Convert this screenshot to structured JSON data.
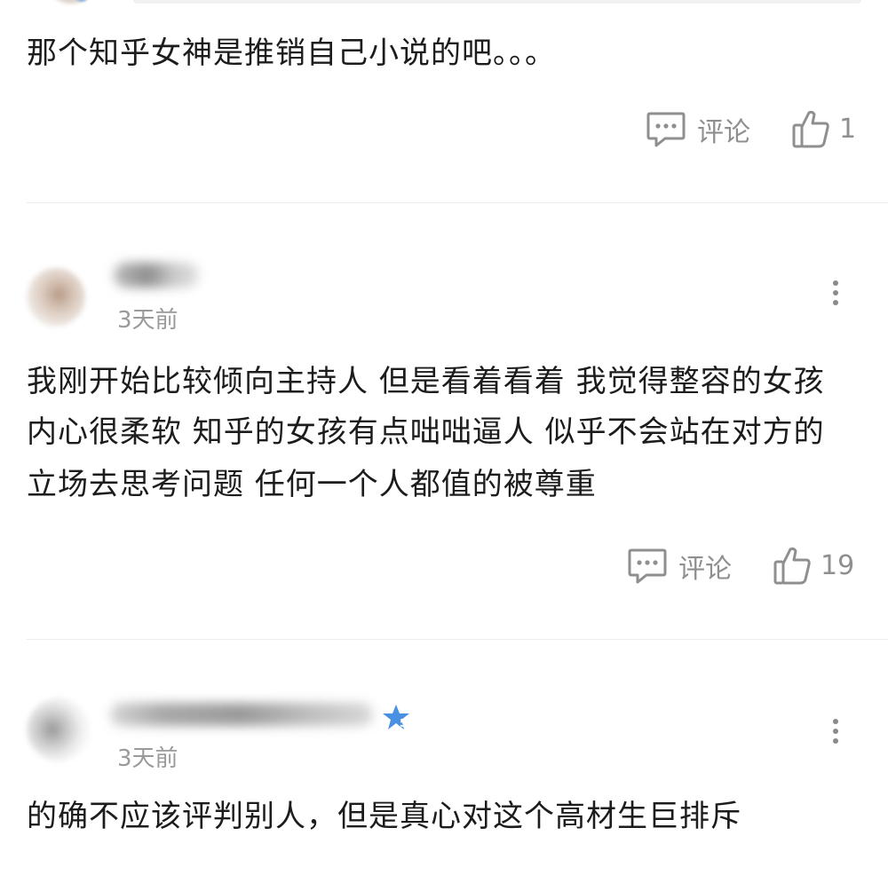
{
  "comments": [
    {
      "text_lines": [
        "那个知乎女神是推销自己小说的吧。。。"
      ],
      "comment_label": "评论",
      "like_count": "1"
    },
    {
      "time": "3天前",
      "text_lines": [
        "我刚开始比较倾向主持人 但是看着看着 我觉得整容的女孩",
        "内心很柔软 知乎的女孩有点咄咄逼人 似乎不会站在对方的",
        "立场去思考问题 任何一个人都值的被尊重"
      ],
      "comment_label": "评论",
      "like_count": "19"
    },
    {
      "time": "3天前",
      "badge_level": "5",
      "text_lines": [
        "的确不应该评判别人，但是真心对这个高材生巨排斥"
      ]
    }
  ],
  "icons": {
    "comment": "comment-bubble-icon",
    "like": "thumbs-up-icon",
    "more": "more-vertical-icon",
    "badge": "star-badge-icon"
  },
  "colors": {
    "text": "#1c1c1c",
    "meta": "#9a9a9a",
    "action": "#8f8f8f",
    "badge": "#4a90e2"
  }
}
